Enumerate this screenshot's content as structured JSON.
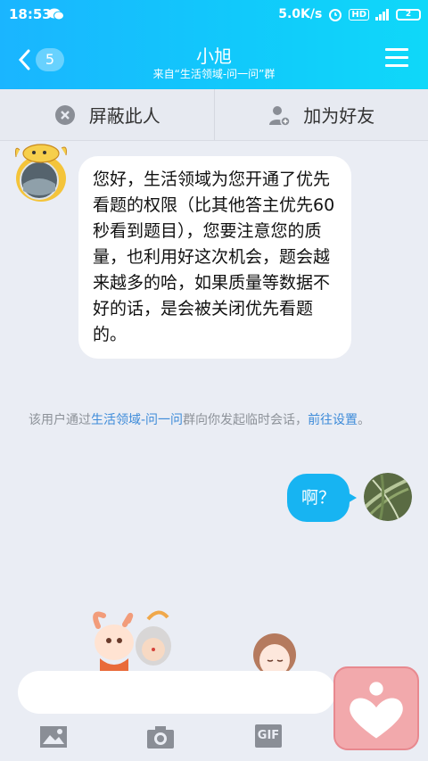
{
  "status": {
    "time": "18:53",
    "speed": "5.0K/s",
    "hd": "HD",
    "battery": "2",
    "signal": "4G"
  },
  "header": {
    "unread_count": "5",
    "title": "小旭",
    "subtitle": "来自“生活领域-问一问”群"
  },
  "actions": {
    "block_label": "屏蔽此人",
    "add_friend_label": "加为好友"
  },
  "messages": [
    {
      "side": "left",
      "text": "您好，生活领域为您开通了优先看题的权限（比其他答主优先60秒看到题目），您要注意您的质量，也利用好这次机会，题会越来越多的哈，如果质量等数据不好的话，是会被关闭优先看题的。"
    },
    {
      "side": "right",
      "text": "啊？"
    }
  ],
  "system_message": {
    "prefix": "该用户通过",
    "group_link": "生活领域-问一问",
    "middle": "群向你发起临时会话，",
    "settings_link": "前往设置",
    "suffix": "。"
  },
  "toolbar": {
    "gif_label": "GIF"
  },
  "colors": {
    "accent": "#17b4f2",
    "link": "#3d8bd9",
    "heart_bg": "#f2a9ac"
  }
}
